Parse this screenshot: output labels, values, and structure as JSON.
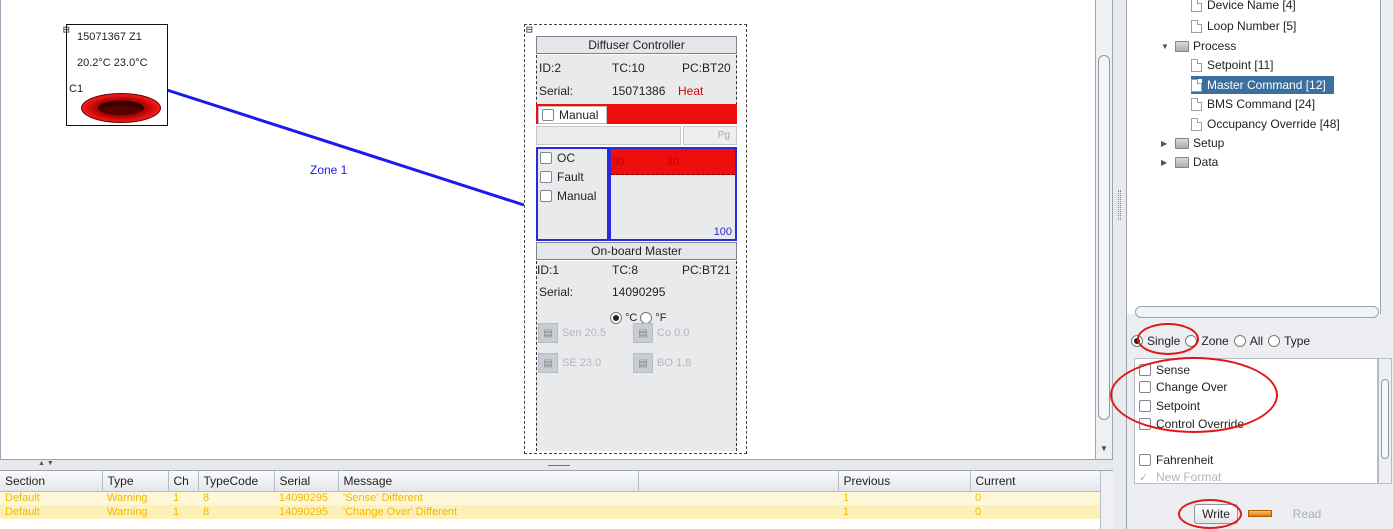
{
  "node": {
    "expander": "⊞",
    "serial_zone": "15071367  Z1",
    "temps": "20.2°C 23.0°C",
    "port": "C1"
  },
  "zone_label": "Zone 1",
  "controller": {
    "collapse": "⊟",
    "title": "Diffuser Controller",
    "id": "ID:2",
    "tc": "TC:10",
    "pc": "PC:BT20",
    "serial_label": "Serial:",
    "serial": "15071386",
    "mode": "Heat",
    "manual": "Manual",
    "pg": "Pg",
    "status_checks": [
      "OC",
      "Fault",
      "Manual"
    ],
    "chart_low": "30",
    "chart_value": "30",
    "chart_max": "100",
    "master_title": "On-board Master",
    "master_id": "ID:1",
    "master_tc": "TC:8",
    "master_pc": "PC:BT21",
    "master_serial": "14090295",
    "unit_c": "°C",
    "unit_f": "°F",
    "tiles": [
      {
        "label": "Sen",
        "value": "20.5"
      },
      {
        "label": "Co",
        "value": "0.0"
      },
      {
        "label": "SE",
        "value": "23.0"
      },
      {
        "label": "BO",
        "value": "1.8"
      }
    ]
  },
  "log": {
    "columns": [
      "Section",
      "Type",
      "Ch",
      "TypeCode",
      "Serial",
      "Message",
      "",
      "Previous",
      "Current"
    ],
    "rows": [
      [
        "Default",
        "Warning",
        "1",
        "8",
        "14090295",
        "'Sense' Different",
        "",
        "1",
        "0"
      ],
      [
        "Default",
        "Warning",
        "1",
        "8",
        "14090295",
        "'Change Over' Different",
        "",
        "1",
        "0"
      ]
    ]
  },
  "tree": {
    "items": [
      {
        "label": "Device Name [4]",
        "kind": "file"
      },
      {
        "label": "Loop Number [5]",
        "kind": "file"
      },
      {
        "label": "Process",
        "kind": "folder-open"
      },
      {
        "label": "Setpoint [11]",
        "kind": "file"
      },
      {
        "label": "Master Command [12]",
        "kind": "file",
        "selected": true
      },
      {
        "label": "BMS Command [24]",
        "kind": "file"
      },
      {
        "label": "Occupancy Override [48]",
        "kind": "file"
      },
      {
        "label": "Setup",
        "kind": "folder"
      },
      {
        "label": "Data",
        "kind": "folder"
      }
    ]
  },
  "scope": {
    "options": [
      "Single",
      "Zone",
      "All",
      "Type"
    ],
    "selected": "Single"
  },
  "write_fields": [
    "Sense",
    "Change Over",
    "Setpoint",
    "Control Override"
  ],
  "fahrenheit": "Fahrenheit",
  "new_format": "New Format",
  "write_label": "Write",
  "read_label": "Read",
  "accent_red": "#ee0e0e",
  "selection_blue": "#3d6f9e"
}
